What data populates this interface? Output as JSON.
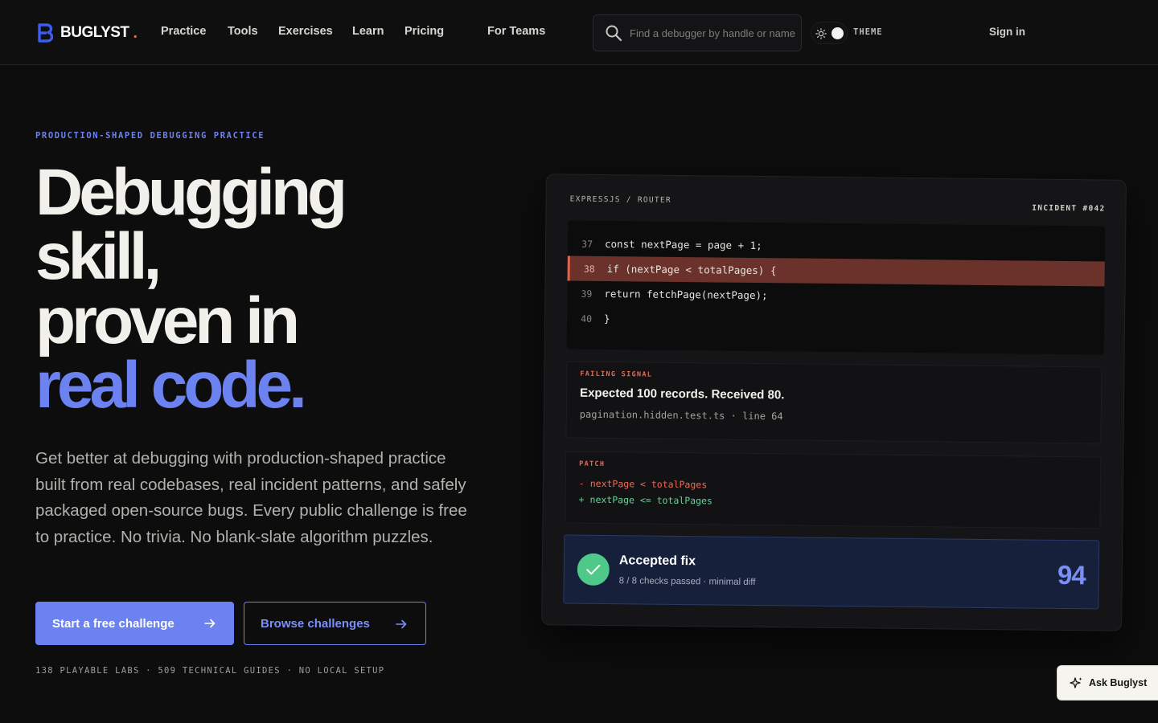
{
  "brand": {
    "name": "BUGLYST",
    "dot": ".",
    "logo_icon": "b-logo-mark",
    "accent_color": "#6b82f0"
  },
  "nav": {
    "links": [
      "Practice",
      "Tools",
      "Exercises",
      "Learn",
      "Pricing",
      "For Teams"
    ],
    "search_placeholder": "Find a debugger by handle or name",
    "theme_label": "THEME",
    "theme_icon": "sun-icon",
    "sign_in": "Sign in"
  },
  "hero": {
    "eyebrow": "PRODUCTION-SHAPED DEBUGGING PRACTICE",
    "headline": [
      "Debugging",
      "skill,",
      "proven in"
    ],
    "headline_accent": "real code.",
    "lede": "Get better at debugging with production-shaped practice built from real codebases, real incident patterns, and safely packaged open-source bugs. Every public challenge is free to practice. No trivia. No blank-slate algorithm puzzles.",
    "primary_cta": "Start a free challenge",
    "secondary_cta": "Browse challenges",
    "stats": "138 PLAYABLE LABS · 509 TECHNICAL GUIDES · NO LOCAL SETUP"
  },
  "incident": {
    "breadcrumb": "EXPRESSJS / ROUTER",
    "id": "INCIDENT #042",
    "code": [
      {
        "line": "37",
        "text": "const nextPage = page + 1;",
        "highlight": false
      },
      {
        "line": "38",
        "text": "if (nextPage < totalPages) {",
        "highlight": true
      },
      {
        "line": "39",
        "text": "return fetchPage(nextPage);",
        "highlight": false
      },
      {
        "line": "40",
        "text": "}",
        "highlight": false
      }
    ],
    "signal_tag": "FAILING SIGNAL",
    "signal_message": "Expected 100 records. Received 80.",
    "signal_file": "pagination.hidden.test.ts · line 64",
    "patch_tag": "PATCH",
    "patch_removed": "- nextPage < totalPages",
    "patch_added": "+ nextPage <= totalPages",
    "result_title": "Accepted fix",
    "result_detail": "8 / 8 checks passed · minimal diff",
    "score": "94"
  },
  "assistant": {
    "label": "Ask Buglyst",
    "icon": "sparkle-icon"
  }
}
